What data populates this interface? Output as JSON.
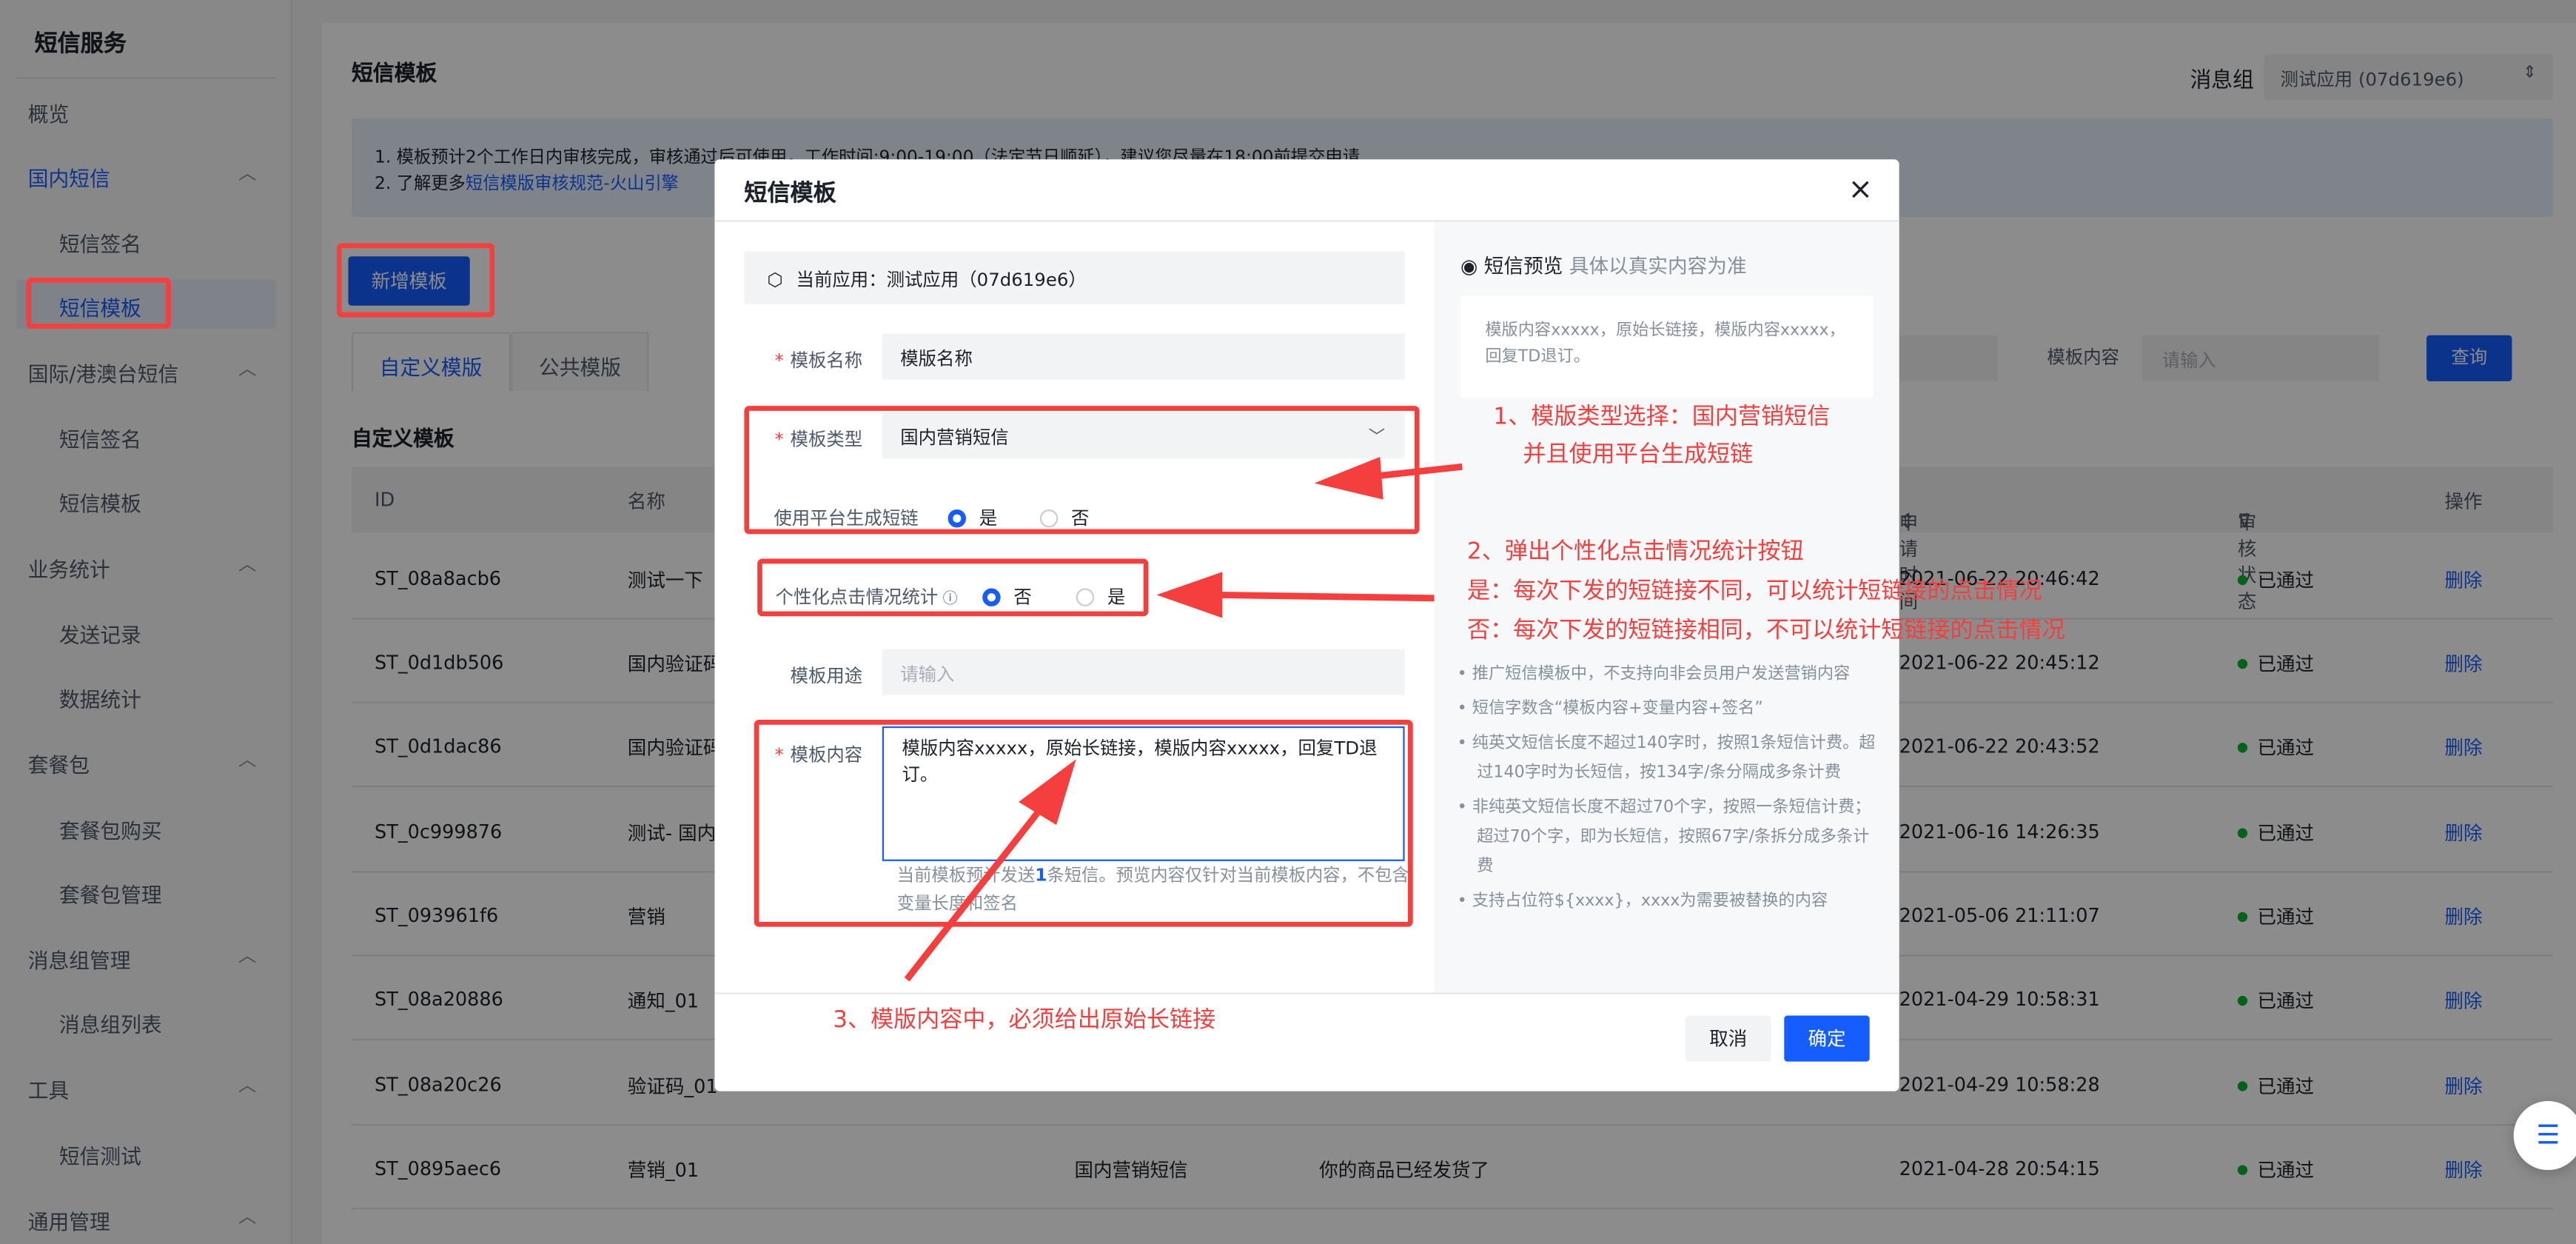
{
  "sidebar": {
    "brand": "短信服务",
    "items": [
      {
        "label": "概览"
      },
      {
        "label": "国内短信"
      },
      {
        "label": "短信签名"
      },
      {
        "label": "短信模板"
      },
      {
        "label": "国际/港澳台短信"
      },
      {
        "label": "短信签名"
      },
      {
        "label": "短信模板"
      },
      {
        "label": "业务统计"
      },
      {
        "label": "发送记录"
      },
      {
        "label": "数据统计"
      },
      {
        "label": "套餐包"
      },
      {
        "label": "套餐包购买"
      },
      {
        "label": "套餐包管理"
      },
      {
        "label": "消息组管理"
      },
      {
        "label": "消息组列表"
      },
      {
        "label": "工具"
      },
      {
        "label": "短信测试"
      },
      {
        "label": "通用管理"
      }
    ]
  },
  "main": {
    "title": "短信模板",
    "group_label": "消息组",
    "group_value": "测试应用 (07d619e6)",
    "notice_line1": "1. 模板预计2个工作日内审核完成，审核通过后可使用，工作时间:9:00-19:00（法定节日顺延），建议您尽量在18:00前提交申请",
    "notice_line2_prefix": "2. 了解更多",
    "notice_link": "短信模版审核规范-火山引擎",
    "new_button": "新增模板",
    "tab_custom": "自定义模版",
    "tab_public": "公共模版",
    "filter_label": "模板内容",
    "filter_placeholder": "请输入",
    "query_button": "查询",
    "section_title": "自定义模板",
    "columns": {
      "id": "ID",
      "name": "名称",
      "time": "申请时间",
      "status": "审核状态",
      "op": "操作"
    },
    "rows": [
      {
        "id": "ST_08a8acb6",
        "name": "测试一下",
        "type": "",
        "content": "",
        "time": "2021-06-22 20:46:42",
        "status": "已通过",
        "op": "删除"
      },
      {
        "id": "ST_0d1db506",
        "name": "国内验证码",
        "type": "",
        "content": "",
        "time": "2021-06-22 20:45:12",
        "status": "已通过",
        "op": "删除"
      },
      {
        "id": "ST_0d1dac86",
        "name": "国内验证码",
        "type": "",
        "content": "",
        "time": "2021-06-22 20:43:52",
        "status": "已通过",
        "op": "删除"
      },
      {
        "id": "ST_0c999876",
        "name": "测试- 国内",
        "type": "",
        "content": "",
        "time": "2021-06-16 14:26:35",
        "status": "已通过",
        "op": "删除"
      },
      {
        "id": "ST_093961f6",
        "name": "营销",
        "type": "",
        "content": "",
        "time": "2021-05-06 21:11:07",
        "status": "已通过",
        "op": "删除"
      },
      {
        "id": "ST_08a20886",
        "name": "通知_01",
        "type": "",
        "content": "",
        "time": "2021-04-29 10:58:31",
        "status": "已通过",
        "op": "删除"
      },
      {
        "id": "ST_08a20c26",
        "name": "验证码_01",
        "type": "",
        "content": "",
        "time": "2021-04-29 10:58:28",
        "status": "已通过",
        "op": "删除"
      },
      {
        "id": "ST_0895aec6",
        "name": "营销_01",
        "type": "国内营销短信",
        "content": "你的商品已经发货了",
        "time": "2021-04-28 20:54:15",
        "status": "已通过",
        "op": "删除"
      }
    ]
  },
  "modal": {
    "title": "短信模板",
    "close": "×",
    "current_app": "当前应用：测试应用（07d619e6）",
    "name_label": "模板名称",
    "name_value": "模版名称",
    "type_label": "模板类型",
    "type_value": "国内营销短信",
    "shortlink_label": "使用平台生成短链",
    "shortlink_yes": "是",
    "shortlink_no": "否",
    "click_label": "个性化点击情况统计",
    "click_no": "否",
    "click_yes": "是",
    "usage_label": "模板用途",
    "usage_placeholder": "请输入",
    "content_label": "模板内容",
    "content_value": "模版内容xxxxx，原始长链接，模版内容xxxxx，回复TD退订。",
    "hint_prefix": "当前模板预计发送",
    "hint_count": "1",
    "hint_suffix": "条短信。预览内容仅针对当前模板内容，不包含变量长度和签名",
    "preview_title": "短信预览",
    "preview_sub": "具体以真实内容为准",
    "preview_text": "模版内容xxxxx，原始长链接，模版内容xxxxx，回复TD退订。",
    "tips": [
      "推广短信模板中，不支持向非会员用户发送营销内容",
      "短信字数含“模板内容+变量内容+签名”",
      "纯英文短信长度不超过140字时，按照1条短信计费。超过140字时为长短信，按134字/条分隔成多条计费",
      "非纯英文短信长度不超过70个字，按照一条短信计费；超过70个字，即为长短信，按照67字/条拆分成多条计费",
      "支持占位符${xxxx}，xxxx为需要被替换的内容"
    ],
    "cancel": "取消",
    "ok": "确定"
  },
  "annotations": {
    "a1_line1": "1、模版类型选择：国内营销短信",
    "a1_line2": "并且使用平台生成短链",
    "a2_line1": "2、弹出个性化点击情况统计按钮",
    "a2_line2": "是：每次下发的短链接不同，可以统计短链接的点击情况",
    "a2_line3": "否：每次下发的短链接相同，不可以统计短链接的点击情况",
    "a3": "3、模版内容中，必须给出原始长链接"
  },
  "colors": {
    "primary": "#165dff",
    "annotation": "#f53f3f",
    "success": "#00b42a"
  }
}
